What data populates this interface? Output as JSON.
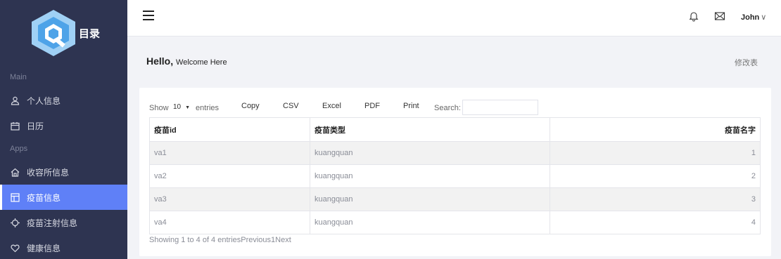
{
  "sidebar": {
    "brand": "目录",
    "sections": {
      "main": "Main",
      "apps": "Apps"
    },
    "main_items": [
      {
        "label": "个人信息",
        "icon": "user-icon"
      },
      {
        "label": "日历",
        "icon": "calendar-icon"
      }
    ],
    "apps_items": [
      {
        "label": "收容所信息",
        "icon": "home-icon"
      },
      {
        "label": "疫苗信息",
        "icon": "table-layout-icon",
        "active": true
      },
      {
        "label": "疫苗注射信息",
        "icon": "crosshair-icon"
      },
      {
        "label": "健康信息",
        "icon": "heart-icon"
      }
    ]
  },
  "header": {
    "user_name": "John",
    "caret": "∨"
  },
  "greeting": {
    "hello": "Hello,",
    "welcome": "Welcome Here",
    "edit_link": "修改表"
  },
  "table_controls": {
    "show_label": "Show",
    "page_length": "10",
    "entries_label": "entries",
    "buttons": [
      "Copy",
      "CSV",
      "Excel",
      "PDF",
      "Print"
    ],
    "search_label": "Search:",
    "search_value": ""
  },
  "table": {
    "columns": [
      "疫苗id",
      "疫苗类型",
      "疫苗名字"
    ],
    "rows": [
      [
        "va1",
        "kuangquan",
        "1"
      ],
      [
        "va2",
        "kuangquan",
        "2"
      ],
      [
        "va3",
        "kuangquan",
        "3"
      ],
      [
        "va4",
        "kuangquan",
        "4"
      ]
    ]
  },
  "footer": {
    "info": "Showing 1 to 4 of 4 entriesPrevious1Next"
  },
  "colors": {
    "sidebar_bg": "#2e3451",
    "active_item": "#5f80f7",
    "logo_light": "#9fd0f5",
    "logo_mid": "#4ea3e8"
  }
}
